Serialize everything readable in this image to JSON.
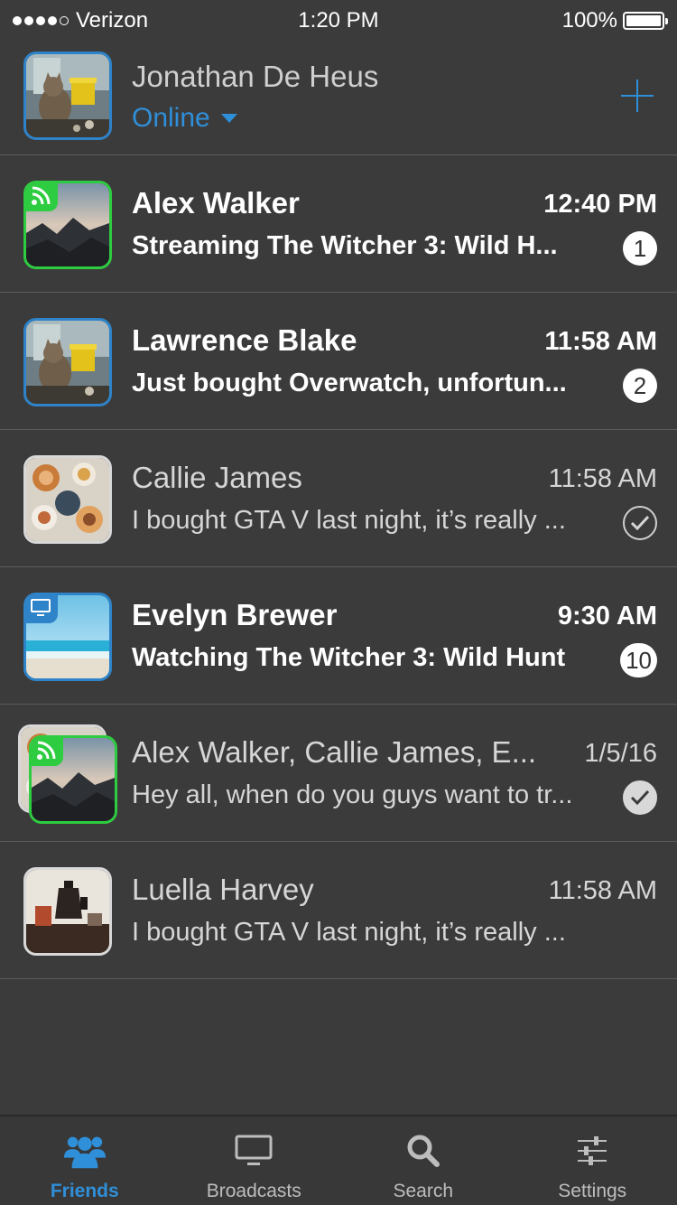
{
  "status_bar": {
    "carrier": "Verizon",
    "time": "1:20 PM",
    "battery": "100%"
  },
  "profile": {
    "name": "Jonathan De Heus",
    "status": "Online",
    "avatar_icon": "cat-photo"
  },
  "conversations": [
    {
      "name": "Alex Walker",
      "time": "12:40 PM",
      "message": "Streaming The Witcher 3: Wild H...",
      "badge": "1",
      "unread": true,
      "avatar_icon": "mountain-photo",
      "border_color": "#2ecc40",
      "overlay_icon": "broadcast-icon"
    },
    {
      "name": "Lawrence Blake",
      "time": "11:58 AM",
      "message": "Just bought Overwatch, unfortun...",
      "badge": "2",
      "unread": true,
      "avatar_icon": "cat-photo",
      "border_color": "#2e83c9"
    },
    {
      "name": "Callie James",
      "time": "11:58 AM",
      "message": "I bought GTA V last night, it’s really ...",
      "unread": false,
      "avatar_icon": "food-photo",
      "border_color": "#d8d8d8",
      "status": "read-outline"
    },
    {
      "name": "Evelyn Brewer",
      "time": "9:30 AM",
      "message": "Watching The Witcher 3: Wild Hunt",
      "badge": "10",
      "unread": true,
      "avatar_icon": "beach-photo",
      "border_color": "#2e83c9",
      "overlay_icon": "monitor-icon"
    },
    {
      "name": "Alex Walker, Callie James, E...",
      "time": "1/5/16",
      "message": "Hey all, when do you guys want to tr...",
      "unread": false,
      "avatar_icon": "group-photo",
      "border_color": "#2ecc40",
      "status": "read-filled"
    },
    {
      "name": "Luella Harvey",
      "time": "11:58 AM",
      "message": "I bought GTA V last night, it’s really ...",
      "unread": false,
      "avatar_icon": "coffee-photo",
      "border_color": "#d8d8d8"
    }
  ],
  "tabs": [
    {
      "label": "Friends",
      "icon": "friends-icon",
      "active": true
    },
    {
      "label": "Broadcasts",
      "icon": "monitor-icon",
      "active": false
    },
    {
      "label": "Search",
      "icon": "search-icon",
      "active": false
    },
    {
      "label": "Settings",
      "icon": "sliders-icon",
      "active": false
    }
  ],
  "colors": {
    "background": "#3b3b3b",
    "accent": "#2f8fd8",
    "online_green": "#2ecc40"
  }
}
